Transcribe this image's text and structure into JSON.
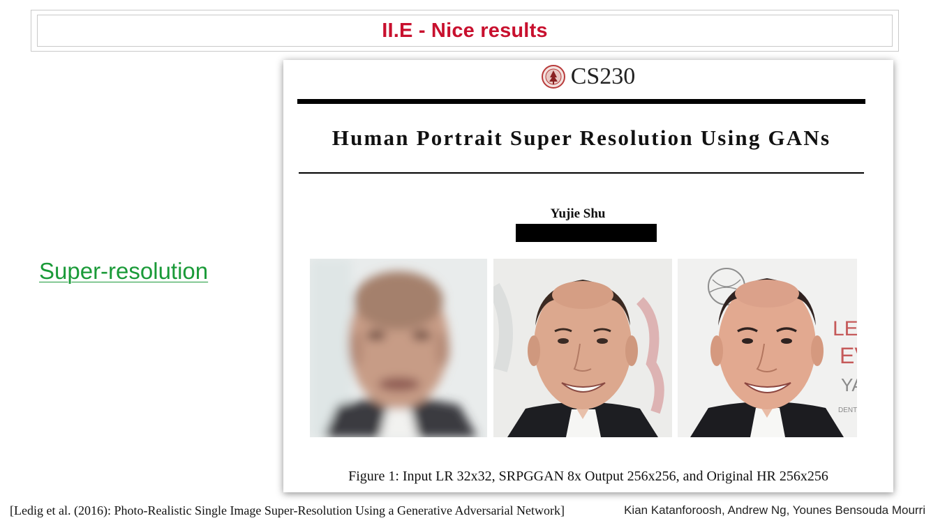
{
  "slide": {
    "title": "II.E - Nice results",
    "side_label": "Super-resolution",
    "citation": "[Ledig et al. (2016): Photo-Realistic Single Image Super-Resolution Using a Generative Adversarial Network]",
    "credits": "Kian Katanforoosh, Andrew Ng, Younes Bensouda Mourri"
  },
  "paper": {
    "header_logo_icon": "stanford-seal-icon",
    "header_text": "CS230",
    "title": "Human Portrait Super Resolution Using GANs",
    "author": "Yujie Shu",
    "figures": [
      {
        "name": "input-lr",
        "kind": "blurry-portrait"
      },
      {
        "name": "srpggan-output",
        "kind": "sharp-portrait"
      },
      {
        "name": "original-hr",
        "kind": "sharp-portrait-with-background-text"
      }
    ],
    "background_letters": [
      "LEG",
      "EV",
      "YA",
      "DENT"
    ],
    "caption": "Figure 1: Input LR 32x32, SRPGGAN 8x Output 256x256, and Original HR 256x256"
  },
  "colors": {
    "title_red": "#c8102e",
    "link_green": "#1a9a38",
    "seal_red": "#b83a3a"
  }
}
